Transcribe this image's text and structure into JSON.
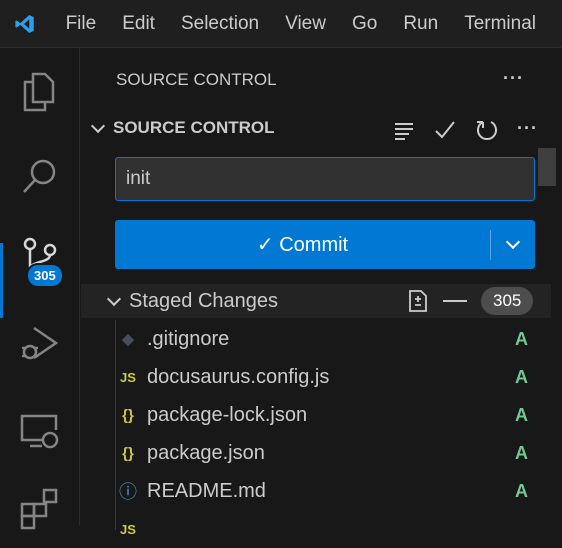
{
  "titlebar": {
    "menus": [
      "File",
      "Edit",
      "Selection",
      "View",
      "Go",
      "Run",
      "Terminal"
    ]
  },
  "activity_bar": {
    "items": [
      "explorer",
      "search",
      "source-control",
      "run-debug",
      "remote-explorer",
      "extensions"
    ],
    "scm_badge": "305"
  },
  "sidebar": {
    "title": "SOURCE CONTROL",
    "section": "SOURCE CONTROL",
    "commit_message": "init",
    "commit_label": "Commit",
    "staged": {
      "label": "Staged Changes",
      "count": "305",
      "files": [
        {
          "name": ".gitignore",
          "icon": "git-icon",
          "status": "A"
        },
        {
          "name": "docusaurus.config.js",
          "icon": "js-icon",
          "status": "A"
        },
        {
          "name": "package-lock.json",
          "icon": "json-icon",
          "status": "A"
        },
        {
          "name": "package.json",
          "icon": "json-icon",
          "status": "A"
        },
        {
          "name": "README.md",
          "icon": "info-icon",
          "status": "A"
        }
      ]
    }
  },
  "colors": {
    "accent": "#0078d4",
    "added": "#73c991",
    "json": "#cbcb41",
    "js": "#cbcb41",
    "info": "#519aba"
  }
}
